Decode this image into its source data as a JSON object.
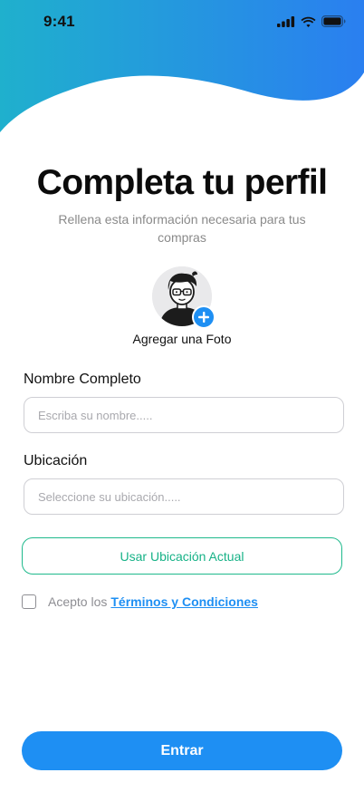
{
  "status_bar": {
    "time": "9:41"
  },
  "header": {
    "title": "Completa tu perfil",
    "subtitle": "Rellena esta información necesaria para tus compras"
  },
  "photo": {
    "label": "Agregar una Foto",
    "icon": "plus-icon"
  },
  "form": {
    "name_label": "Nombre Completo",
    "name_placeholder": "Escriba su nombre.....",
    "location_label": "Ubicación",
    "location_placeholder": "Seleccione su ubicación.....",
    "use_location_label": "Usar Ubicación Actual"
  },
  "terms": {
    "prefix": "Acepto los",
    "link": "Términos y Condiciones",
    "checked": false
  },
  "submit": {
    "label": "Entrar"
  },
  "colors": {
    "brand_blue": "#1e8ff3",
    "header_teal": "#1fb3c9",
    "accent_green": "#17b287"
  }
}
